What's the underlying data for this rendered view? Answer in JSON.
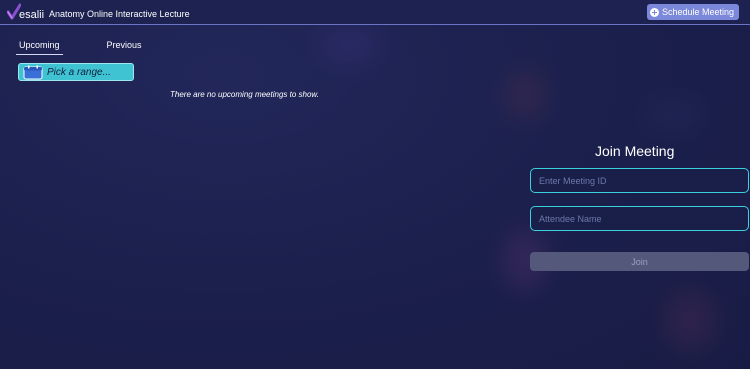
{
  "header": {
    "logo_text": "esalii",
    "app_title": "Anatomy Online Interactive Lecture",
    "schedule_button": "Schedule Meeting"
  },
  "tabs": [
    {
      "label": "Upcoming",
      "active": true
    },
    {
      "label": "Previous",
      "active": false
    }
  ],
  "range_picker": {
    "label": "Pick a range..."
  },
  "empty_message": "There are no upcoming meetings to show.",
  "join": {
    "title": "Join Meeting",
    "meeting_id_placeholder": "Enter Meeting ID",
    "attendee_placeholder": "Attendee Name",
    "button": "Join"
  },
  "colors": {
    "background": "#1b1f4b",
    "accent": "#3fc3d2",
    "schedule_button": "#7c88d9",
    "logo_check": "#8a4fd0"
  },
  "icons": [
    "check-logo-icon",
    "plus-circle-icon",
    "calendar-icon"
  ]
}
